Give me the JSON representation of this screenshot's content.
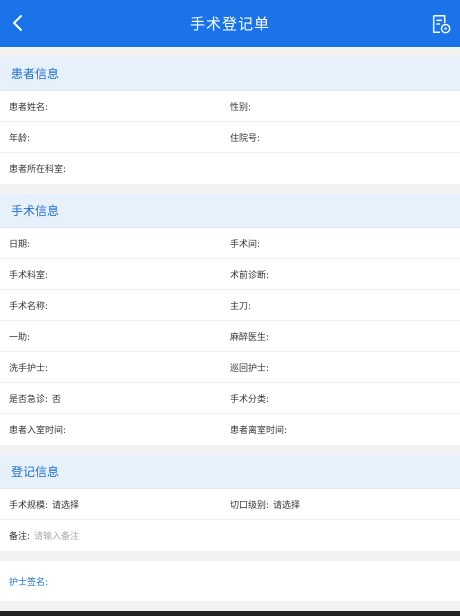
{
  "header": {
    "title": "手术登记单",
    "back_icon": "chevron-left-icon",
    "record_icon": "document-settings-icon",
    "accent": "#1a73e8"
  },
  "patient": {
    "title": "患者信息",
    "name_label": "患者姓名:",
    "gender_label": "性别:",
    "age_label": "年龄:",
    "admission_label": "住院号:",
    "department_label": "患者所在科室:"
  },
  "surgery": {
    "title": "手术信息",
    "date_label": "日期:",
    "room_label": "手术间:",
    "dept_label": "手术科室:",
    "diagnosis_label": "术前诊断:",
    "name_label": "手术名称:",
    "surgeon_label": "主刀:",
    "assistant_label": "一助:",
    "anesthetist_label": "麻醉医生:",
    "scrub_nurse_label": "洗手护士:",
    "circulating_nurse_label": "巡回护士:",
    "emergency_label": "是否急诊:",
    "emergency_value": "否",
    "category_label": "手术分类:",
    "enter_time_label": "患者入室时间:",
    "leave_time_label": "患者离室时间:"
  },
  "registration": {
    "title": "登记信息",
    "scale_label": "手术规模:",
    "scale_value": "请选择",
    "incision_label": "切口级别:",
    "incision_value": "请选择",
    "remark_label": "备注:",
    "remark_placeholder": "请输入备注"
  },
  "signature": {
    "label": "护士签名:"
  }
}
